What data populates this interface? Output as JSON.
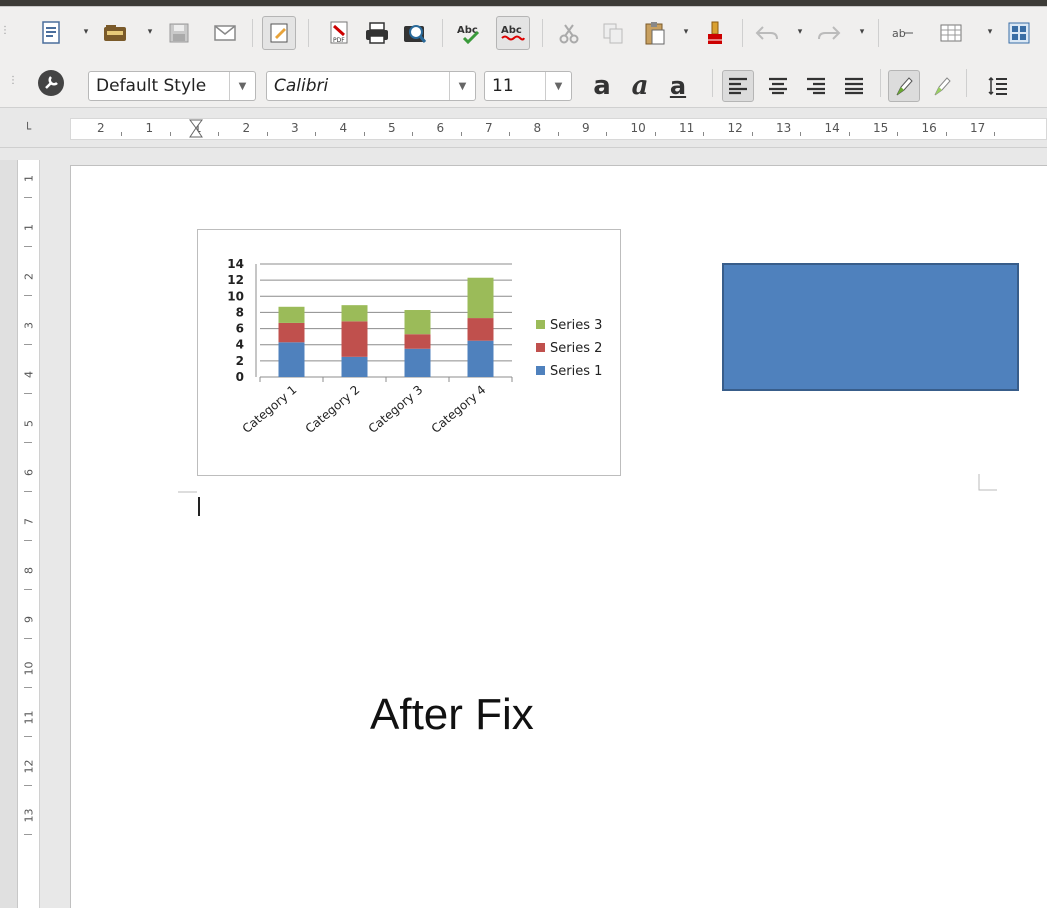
{
  "toolbar_standard": {
    "icons": [
      "new-document-icon",
      "open-icon",
      "save-icon",
      "email-icon",
      "edit-mode-icon",
      "export-pdf-icon",
      "print-icon",
      "print-preview-icon",
      "spelling-icon",
      "autospell-icon",
      "cut-icon",
      "copy-icon",
      "paste-icon",
      "clone-formatting-icon",
      "undo-icon",
      "redo-icon",
      "find-replace-icon",
      "insert-table-icon",
      "insert-image-icon"
    ]
  },
  "toolbar_formatting": {
    "paragraph_style": "Default Style",
    "font_name": "Calibri",
    "font_size": "11",
    "bold_glyph": "a",
    "italic_glyph": "a",
    "underline_glyph": "a"
  },
  "ruler": {
    "h_numbers": [
      "2",
      "1",
      "1",
      "2",
      "3",
      "4",
      "5",
      "6",
      "7",
      "8",
      "9",
      "10",
      "11",
      "12",
      "13",
      "14",
      "15",
      "16",
      "17"
    ],
    "v_numbers": [
      "1",
      "1",
      "2",
      "3",
      "4",
      "5",
      "6",
      "7",
      "8",
      "9",
      "10",
      "11",
      "12",
      "13"
    ]
  },
  "document": {
    "text": "After Fix"
  },
  "chart_data": {
    "type": "bar",
    "stacked": true,
    "categories": [
      "Category 1",
      "Category 2",
      "Category 3",
      "Category 4"
    ],
    "series": [
      {
        "name": "Series 1",
        "values": [
          4.3,
          2.5,
          3.5,
          4.5
        ],
        "color": "#4f81bd"
      },
      {
        "name": "Series 2",
        "values": [
          2.4,
          4.4,
          1.8,
          2.8
        ],
        "color": "#c0504d"
      },
      {
        "name": "Series 3",
        "values": [
          2.0,
          2.0,
          3.0,
          5.0
        ],
        "color": "#9bbb59"
      }
    ],
    "y_ticks": [
      "0",
      "2",
      "4",
      "6",
      "8",
      "10",
      "12",
      "14"
    ],
    "ylim": [
      0,
      14
    ],
    "legend": "right",
    "grid": true
  }
}
